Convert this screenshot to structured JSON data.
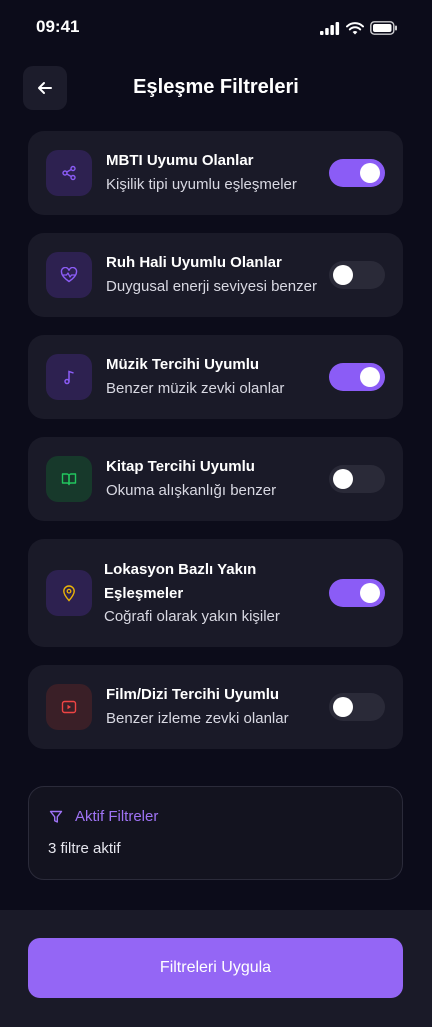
{
  "status_bar": {
    "time": "09:41"
  },
  "header": {
    "title": "Eşleşme Filtreleri",
    "back_icon": "arrow-left-icon"
  },
  "filters": [
    {
      "title": "MBTI Uyumu Olanlar",
      "title2": "",
      "subtitle": "Kişilik tipi uyumlu eşleşmeler",
      "icon": "share-nodes-icon",
      "enabled": true,
      "icon_color": "#8b5cf6"
    },
    {
      "title": "Ruh Hali Uyumlu Olanlar",
      "title2": "",
      "subtitle": "Duygusal enerji seviyesi benzer",
      "icon": "heart-pulse-icon",
      "enabled": false,
      "icon_color": "#8b5cf6"
    },
    {
      "title": "Müzik Tercihi Uyumlu",
      "title2": "",
      "subtitle": "Benzer müzik zevki olanlar",
      "icon": "music-note-icon",
      "enabled": true,
      "icon_color": "#8b5cf6"
    },
    {
      "title": "Kitap Tercihi Uyumlu",
      "title2": "",
      "subtitle": "Okuma alışkanlığı benzer",
      "icon": "open-book-icon",
      "enabled": false,
      "icon_color": "#22c55e"
    },
    {
      "title": "Lokasyon Bazlı Yakın",
      "title2": "Eşleşmeler",
      "subtitle": "Coğrafi olarak yakın kişiler",
      "icon": "map-pin-icon",
      "enabled": true,
      "icon_color": "#eab308"
    },
    {
      "title": "Film/Dizi Tercihi Uyumlu",
      "title2": "",
      "subtitle": "Benzer izleme zevki olanlar",
      "icon": "play-screen-icon",
      "enabled": false,
      "icon_color": "#ef4444"
    }
  ],
  "active_filters": {
    "title": "Aktif Filtreler",
    "count_text": "3 filtre aktif",
    "icon": "filter-funnel-icon"
  },
  "footer": {
    "apply_label": "Filtreleri Uygula"
  },
  "colors": {
    "accent": "#8b5cf6",
    "background": "#0c0c1a",
    "card": "#1a1a28"
  }
}
